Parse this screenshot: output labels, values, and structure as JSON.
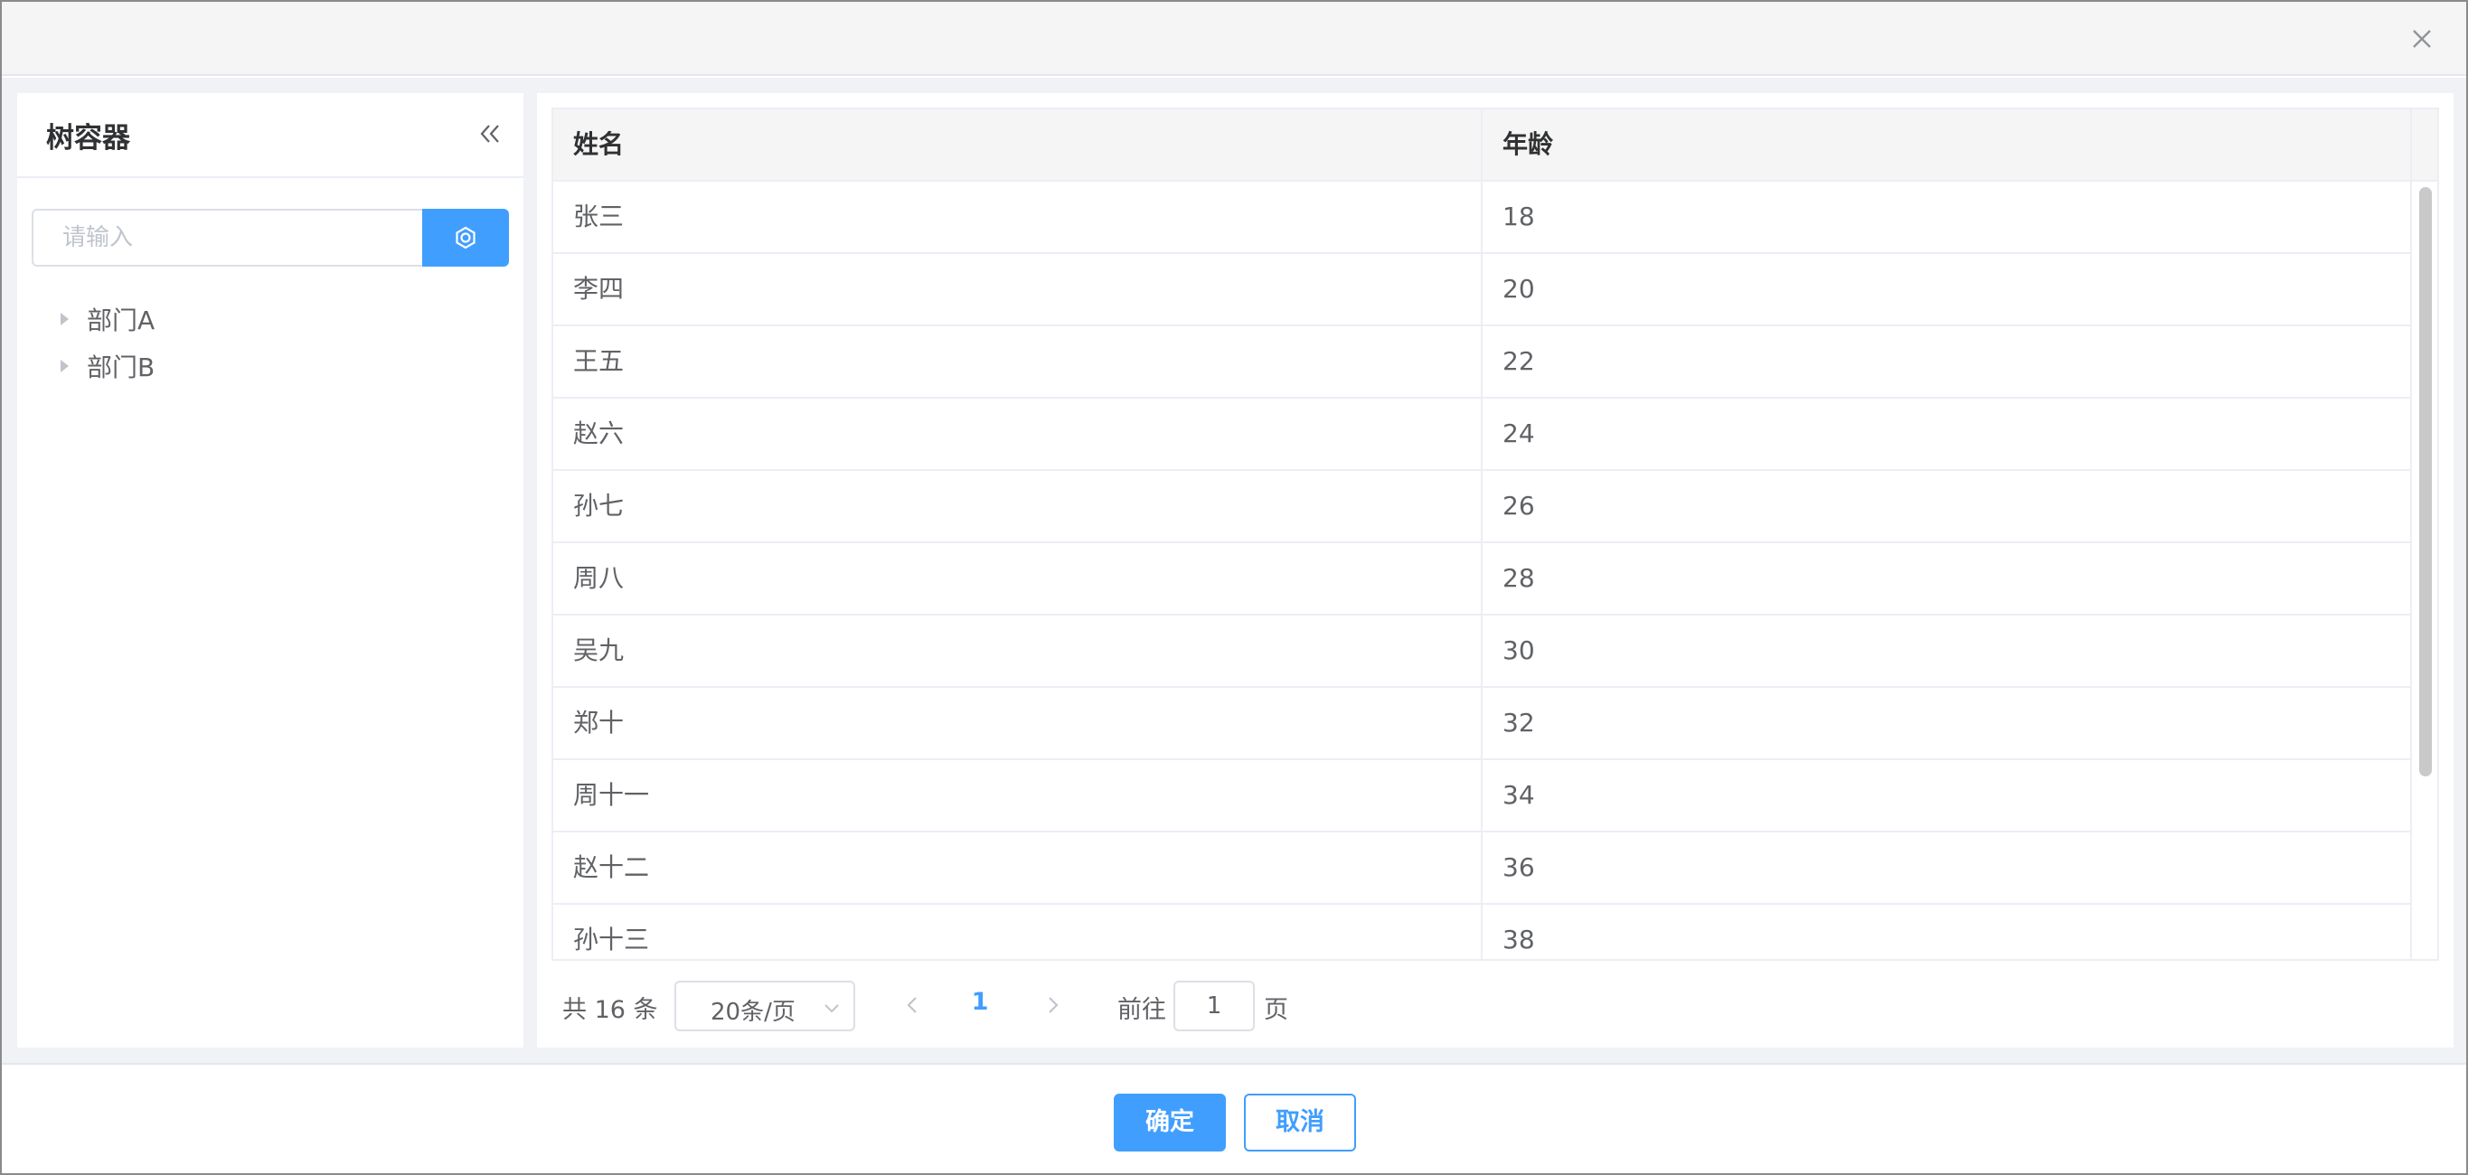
{
  "dialog": {
    "close_icon": "close-icon"
  },
  "tree": {
    "title": "树容器",
    "collapse_icon": "double-chevron-left-icon",
    "search_placeholder": "请输入",
    "search_value": "",
    "search_button_icon": "settings-icon",
    "nodes": [
      {
        "label": "部门A",
        "expanded": false
      },
      {
        "label": "部门B",
        "expanded": false
      }
    ]
  },
  "table": {
    "columns": [
      "姓名",
      "年龄"
    ],
    "rows": [
      {
        "name": "张三",
        "age": "18"
      },
      {
        "name": "李四",
        "age": "20"
      },
      {
        "name": "王五",
        "age": "22"
      },
      {
        "name": "赵六",
        "age": "24"
      },
      {
        "name": "孙七",
        "age": "26"
      },
      {
        "name": "周八",
        "age": "28"
      },
      {
        "name": "吴九",
        "age": "30"
      },
      {
        "name": "郑十",
        "age": "32"
      },
      {
        "name": "周十一",
        "age": "34"
      },
      {
        "name": "赵十二",
        "age": "36"
      },
      {
        "name": "孙十三",
        "age": "38"
      }
    ]
  },
  "pagination": {
    "total_text": "共 16 条",
    "page_size": "20条/页",
    "current_page": "1",
    "goto_label": "前往",
    "goto_value": "1",
    "goto_suffix": "页"
  },
  "footer": {
    "ok_label": "确定",
    "cancel_label": "取消"
  },
  "colors": {
    "primary": "#409eff",
    "header_bg": "#f5f5f5",
    "body_bg": "#f0f2f5"
  }
}
